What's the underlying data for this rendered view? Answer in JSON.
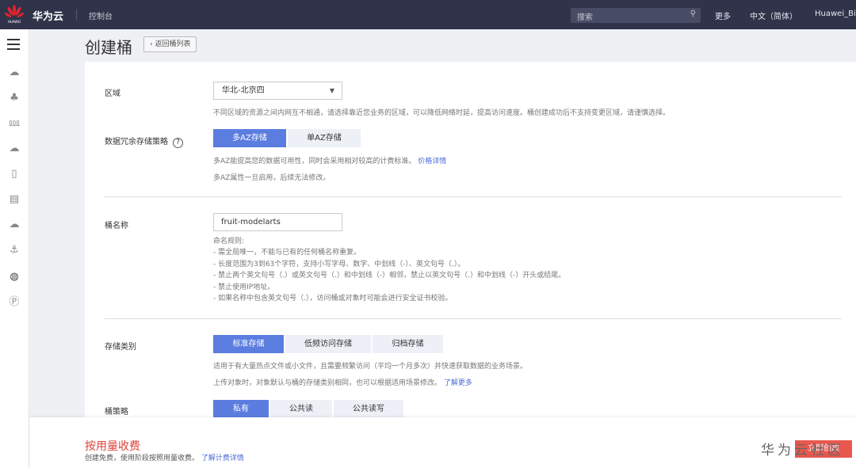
{
  "topbar": {
    "logo_text": "HUAWEI",
    "brand": "华为云",
    "console": "控制台",
    "search_placeholder": "搜索",
    "more": "更多",
    "language": "中文（简体）",
    "user": "Huawei_Bin"
  },
  "sidebar": {
    "icons": [
      "menu-icon",
      "cloud-server-icon",
      "cluster-icon",
      "network-icon",
      "cloud-rds-icon",
      "storage-icon",
      "document-icon",
      "cloud-icon",
      "anchor-icon",
      "globe-icon",
      "parking-icon"
    ]
  },
  "page": {
    "title": "创建桶",
    "back": "返回桶列表"
  },
  "region": {
    "label": "区域",
    "value": "华北-北京四",
    "hint": "不同区域的资源之间内网互不相通，请选择靠近您业务的区域，可以降低网络时延，提高访问速度。桶创建成功后不支持变更区域，请谨慎选择。"
  },
  "redundancy": {
    "label": "数据冗余存储策略",
    "help": "?",
    "options": [
      "多AZ存储",
      "单AZ存储"
    ],
    "selected": 0,
    "hint1": "多AZ能提高您的数据可用性，同时会采用相对较高的计费标准。",
    "hint1_link": "价格详情",
    "hint2": "多AZ属性一旦启用，后续无法修改。"
  },
  "bucket_name": {
    "label": "桶名称",
    "value": "fruit-modelarts",
    "rules": [
      "命名规则:",
      "- 需全局唯一，不能与已有的任何桶名称重复。",
      "- 长度范围为3到63个字符，支持小写字母、数字、中划线（-）、英文句号（.）。",
      "- 禁止两个英文句号（.）或英文句号（.）和中划线（-）相邻，禁止以英文句号（.）和中划线（-）开头或结尾。",
      "- 禁止使用IP地址。",
      "- 如果名称中包含英文句号（.），访问桶或对象时可能会进行安全证书校验。"
    ]
  },
  "storage_class": {
    "label": "存储类别",
    "options": [
      "标准存储",
      "低频访问存储",
      "归档存储"
    ],
    "selected": 0,
    "hint1": "适用于有大量热点文件或小文件，且需要频繁访问（平均一个月多次）并快速获取数据的业务场景。",
    "hint2": "上传对象时，对象默认与桶的存储类别相同，也可以根据适用场景修改。",
    "hint2_link": "了解更多"
  },
  "policy": {
    "label": "桶策略",
    "options": [
      "私有",
      "公共读",
      "公共读写"
    ],
    "selected": 0
  },
  "footer": {
    "title": "按用量收费",
    "sub": "创建免费，使用阶段按照用量收费。",
    "link": "了解计费详情",
    "create": "立即创建",
    "watermark": "华为云社区"
  }
}
